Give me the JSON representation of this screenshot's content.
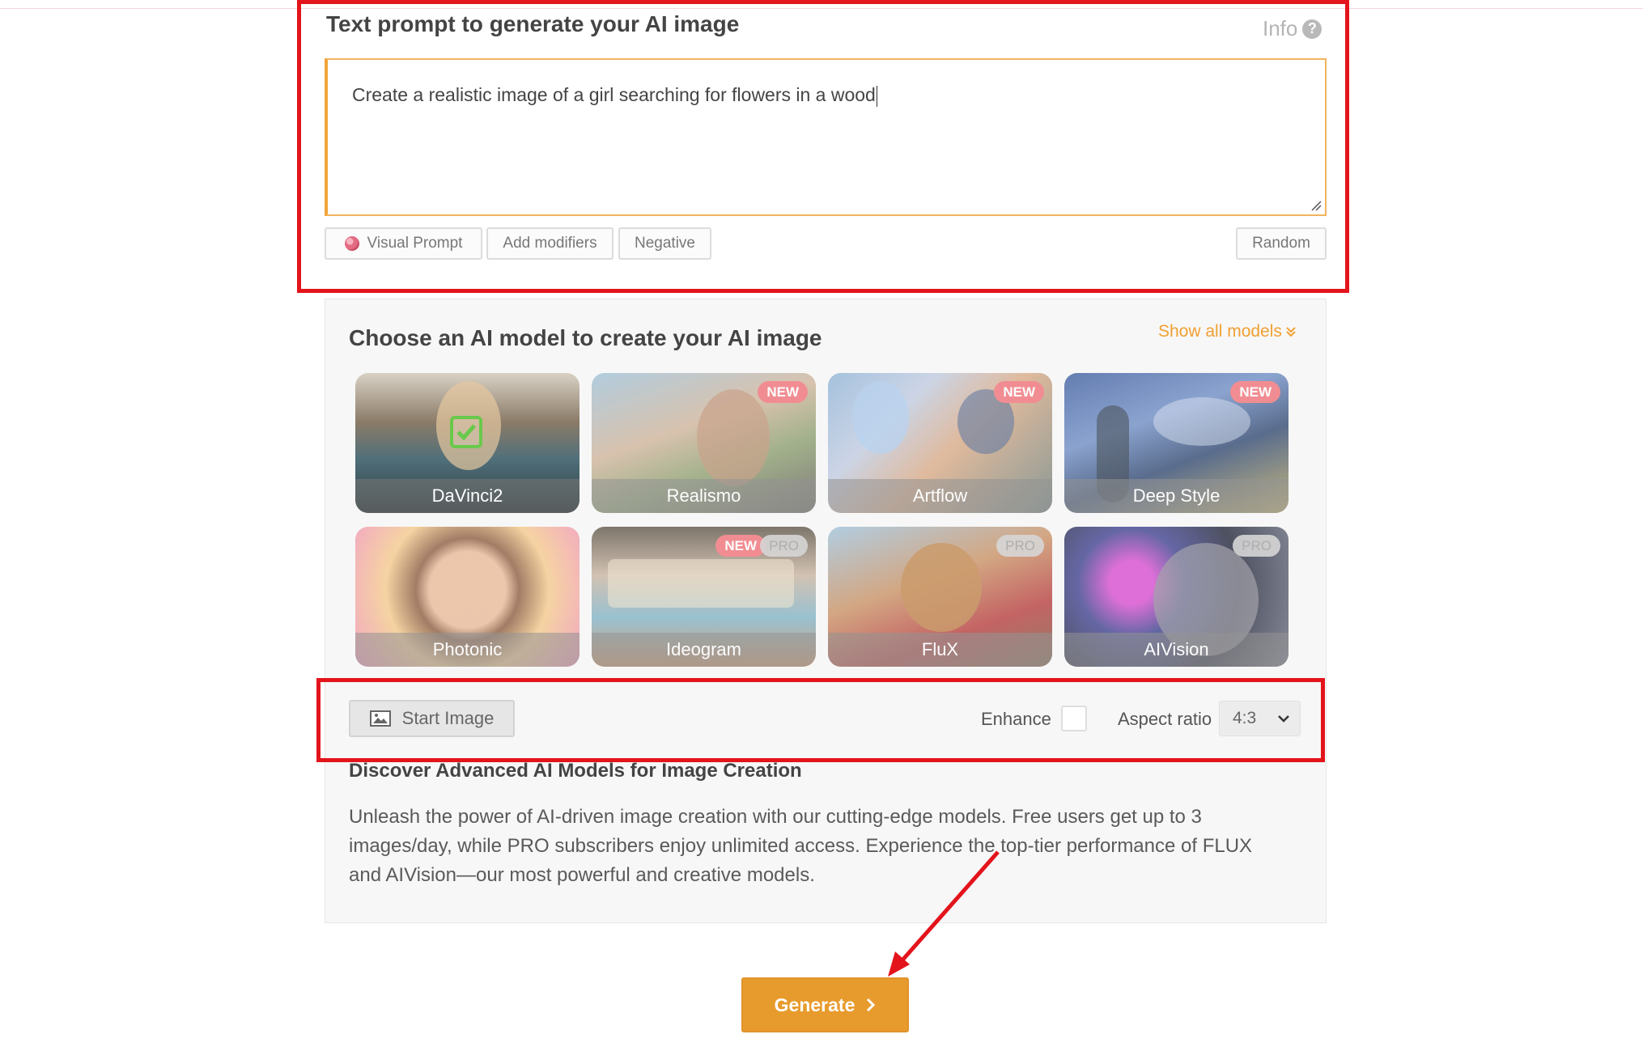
{
  "prompt_section": {
    "title": "Text prompt to generate your AI image",
    "info_label": "Info",
    "prompt_value": "Create a realistic image of a girl searching for flowers in a wood",
    "buttons": {
      "visual_prompt": "Visual Prompt",
      "add_modifiers": "Add modifiers",
      "negative": "Negative",
      "random": "Random"
    }
  },
  "model_section": {
    "title": "Choose an AI model to create your AI image",
    "show_all": "Show all models",
    "models": [
      {
        "name": "DaVinci2",
        "selected": true
      },
      {
        "name": "Realismo",
        "badge": "NEW"
      },
      {
        "name": "Artflow",
        "badge": "NEW"
      },
      {
        "name": "Deep Style",
        "badge": "NEW"
      },
      {
        "name": "Photonic"
      },
      {
        "name": "Ideogram",
        "badge": "NEW",
        "badge2": "PRO"
      },
      {
        "name": "FluX",
        "badge": "PRO"
      },
      {
        "name": "AIVision",
        "badge": "PRO"
      }
    ]
  },
  "options": {
    "start_image": "Start Image",
    "enhance_label": "Enhance",
    "enhance_checked": false,
    "aspect_label": "Aspect ratio",
    "aspect_value": "4:3"
  },
  "discover": {
    "title": "Discover Advanced AI Models for Image Creation",
    "body": "Unleash the power of AI-driven image creation with our cutting-edge models. Free users get up to 3 images/day, while PRO subscribers enjoy unlimited access. Experience the top-tier performance of FLUX and AIVision—our most powerful and creative models."
  },
  "generate_label": "Generate",
  "colors": {
    "annotation": "#e3141b",
    "accent": "#e89b2d",
    "badge_new": "#f07076",
    "checkmark": "#68c94b"
  },
  "icons": [
    "help-icon",
    "palette-icon",
    "resize-grip-icon",
    "chevron-double-down-icon",
    "checkmark-icon",
    "image-icon",
    "chevron-down-icon",
    "chevron-right-icon",
    "annotation-arrow"
  ]
}
